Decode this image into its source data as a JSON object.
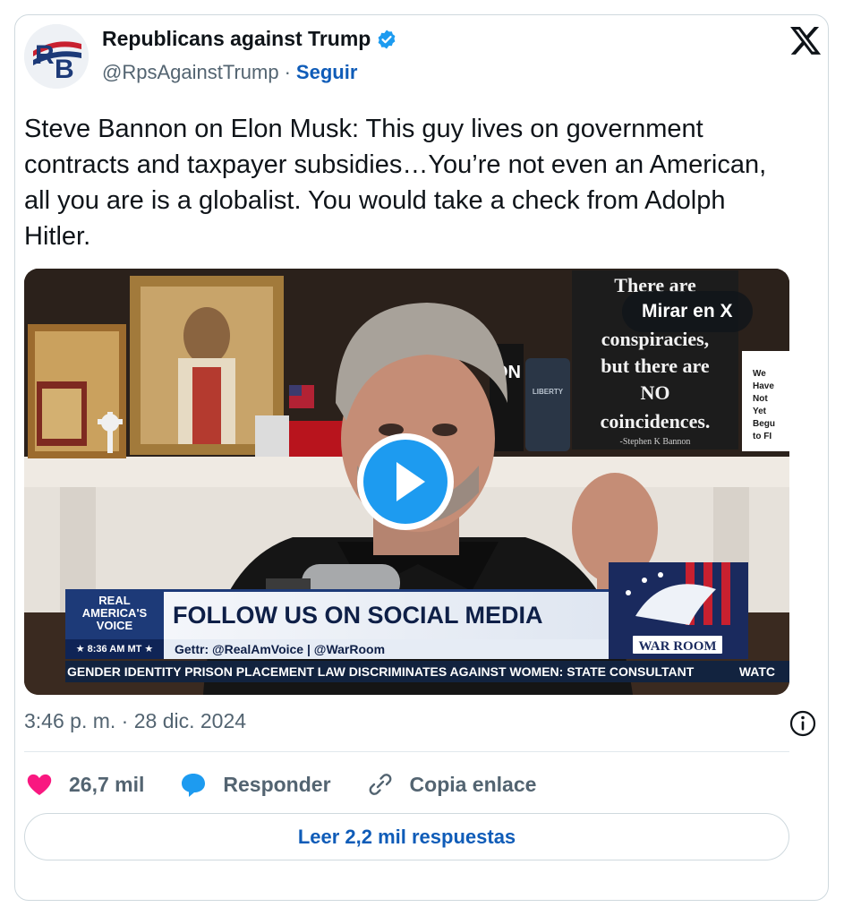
{
  "author": {
    "name": "Republicans against Trump",
    "handle": "@RpsAgainstTrump",
    "separator": "·",
    "follow_label": "Seguir",
    "verified": true,
    "avatar_letters": "RB"
  },
  "tweet": {
    "text": "Steve Bannon on Elon Musk:  This guy lives on government contracts and taxpayer subsidies…You’re not even an American, all you are is a globalist. You would take a check from Adolph Hitler."
  },
  "video": {
    "watch_on_x_label": "Mirar en X",
    "sign_lines": [
      "There are",
      "conspiracies,",
      "but there are",
      "NO",
      "coincidences."
    ],
    "sign_signature": "-Stephen K Bannon",
    "sign_small_lines": [
      "We",
      "Have",
      "Not",
      "Yet",
      "Begu",
      "to FI"
    ],
    "mug_text": "LIBERTY",
    "background_text": "ON",
    "network_lines": [
      "REAL",
      "AMERICA'S",
      "VOICE"
    ],
    "network_time": "8:36 AM MT",
    "banner_text": "FOLLOW US ON SOCIAL MEDIA",
    "gettr_text": "Gettr: @RealAmVoice | @WarRoom",
    "warroom_text": "WAR ROOM",
    "ticker_text": "GENDER IDENTITY PRISON PLACEMENT LAW DISCRIMINATES AGAINST WOMEN: STATE CONSULTANT",
    "ticker_next": "WATC"
  },
  "footer": {
    "timestamp": "3:46 p. m. · 28 dic. 2024",
    "likes_label": "26,7 mil",
    "reply_label": "Responder",
    "copy_link_label": "Copia enlace",
    "read_replies_label": "Leer 2,2 mil respuestas"
  },
  "colors": {
    "accent_blue": "#1d9bf0",
    "link_blue": "#0f5cb8",
    "like_pink": "#f91880",
    "muted": "#536471"
  }
}
